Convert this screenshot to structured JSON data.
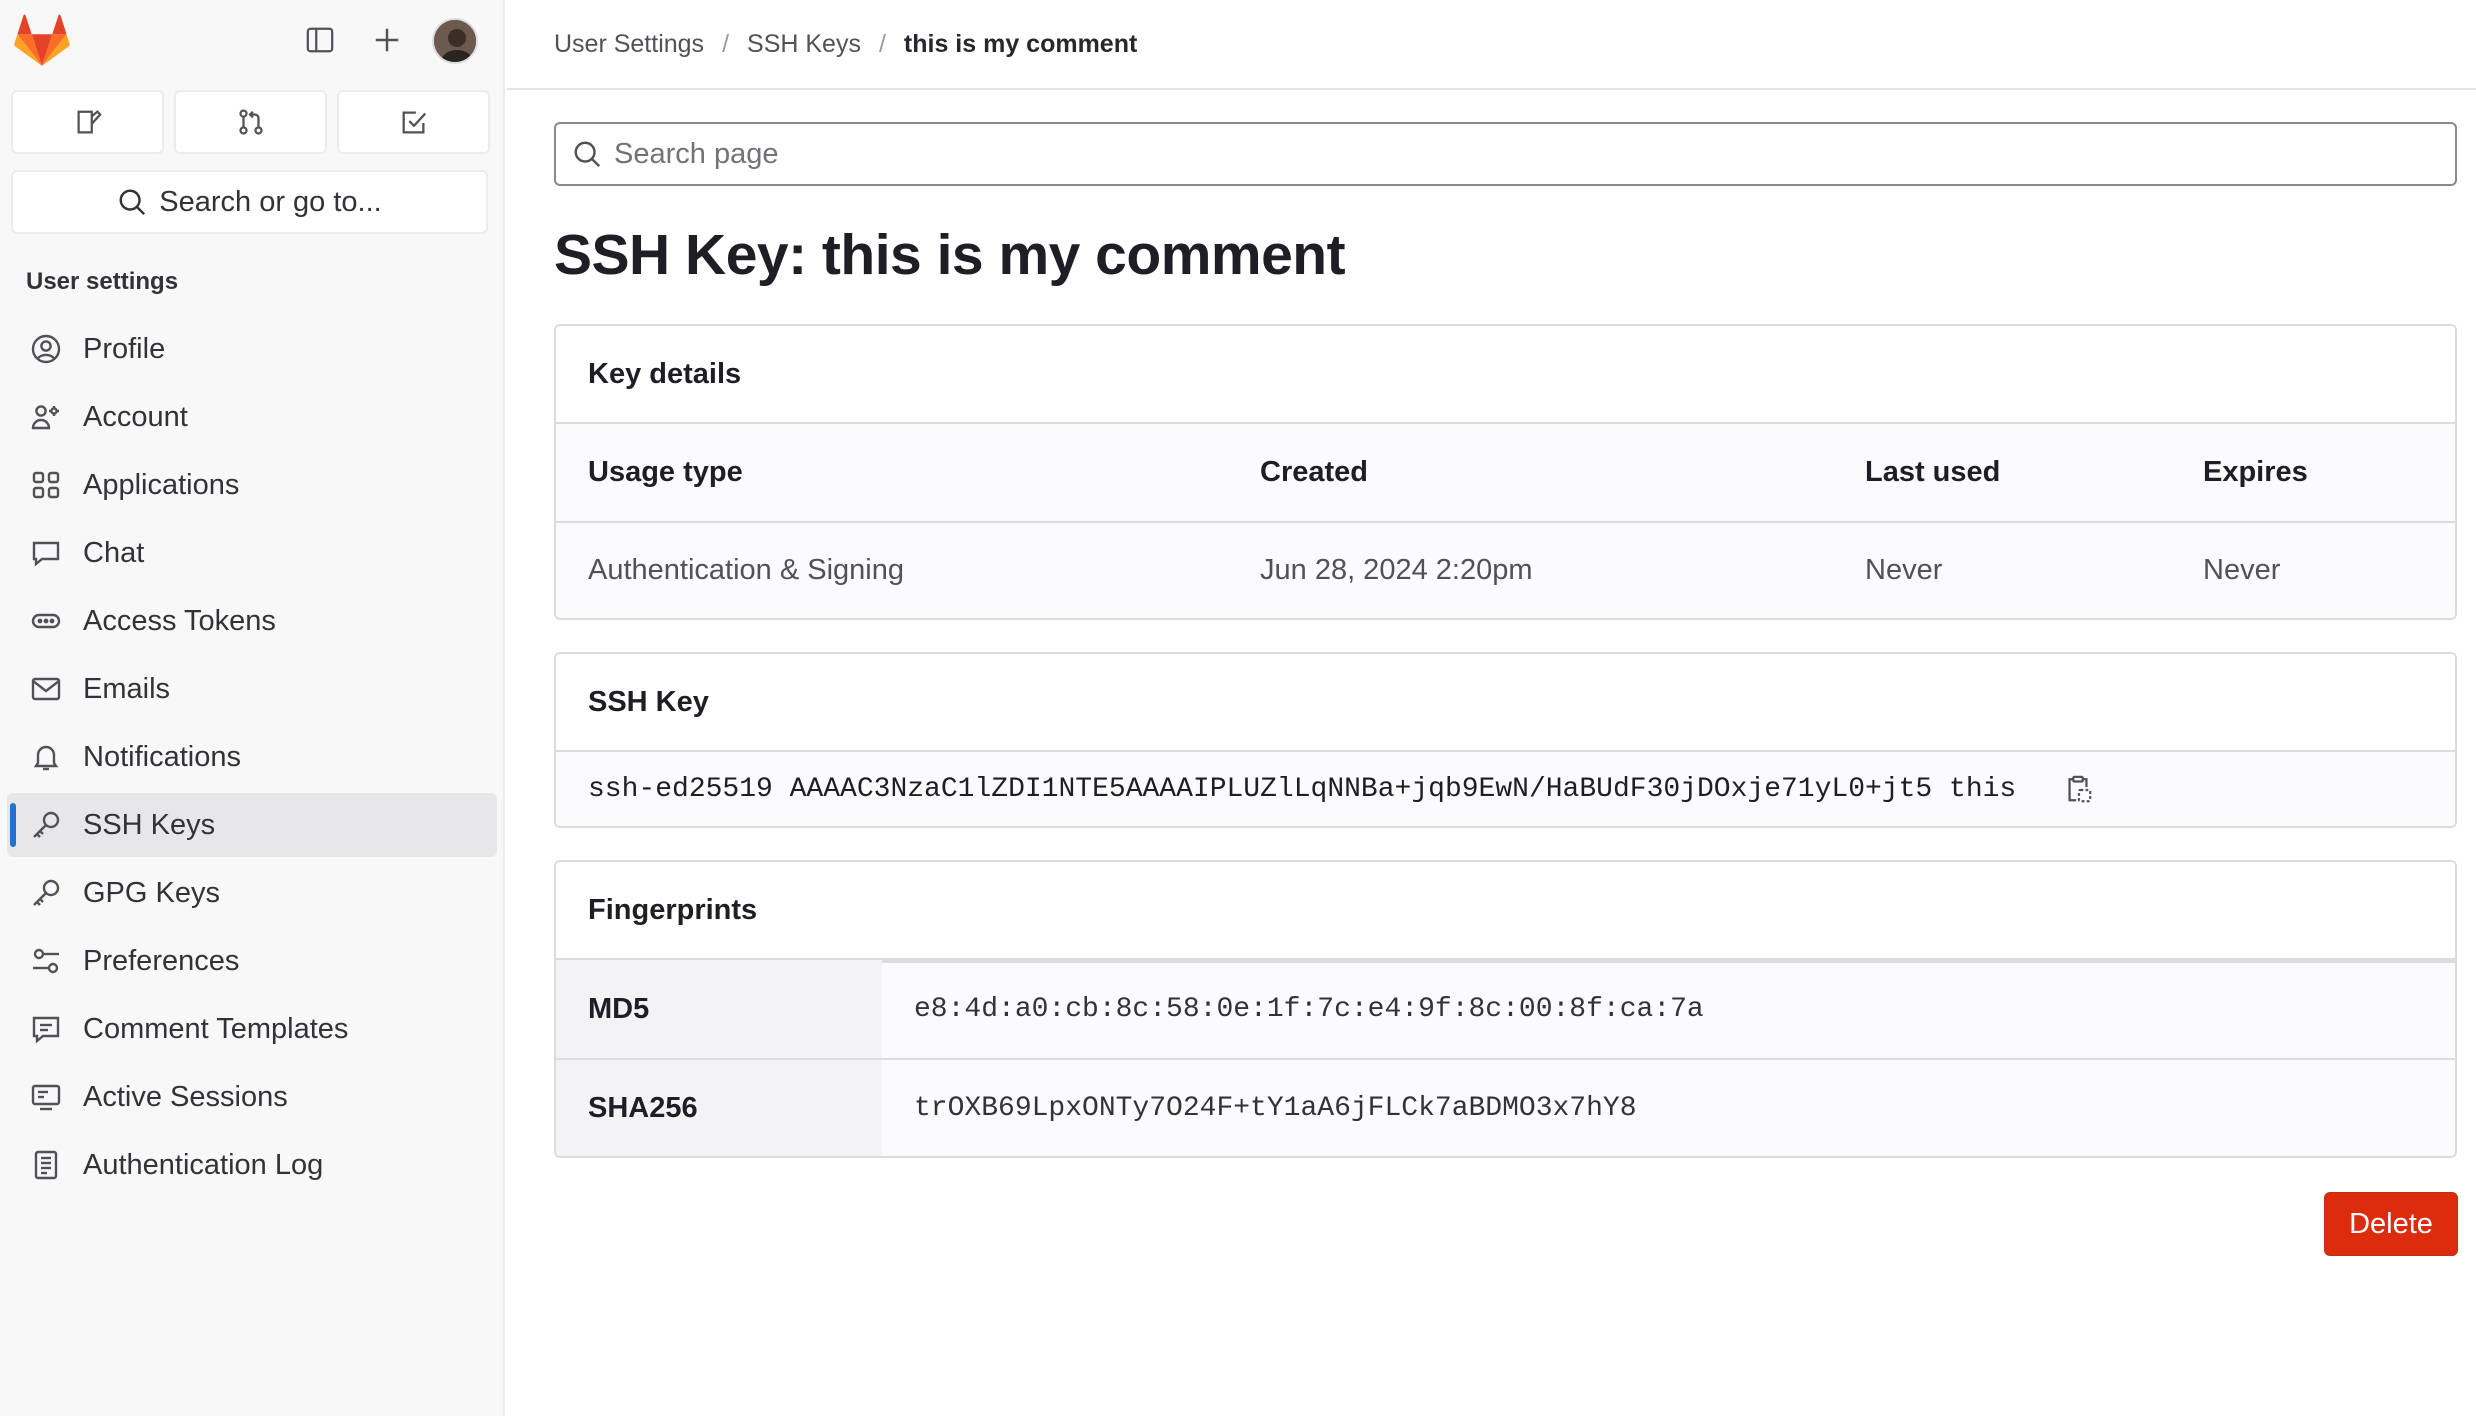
{
  "sidebar": {
    "quick_actions": [
      {
        "icon": "issues-icon"
      },
      {
        "icon": "merge-request-icon"
      },
      {
        "icon": "todo-icon"
      }
    ],
    "search_label": "Search or go to...",
    "section_title": "User settings",
    "items": [
      {
        "label": "Profile",
        "icon": "profile-icon"
      },
      {
        "label": "Account",
        "icon": "account-icon"
      },
      {
        "label": "Applications",
        "icon": "applications-icon"
      },
      {
        "label": "Chat",
        "icon": "chat-icon"
      },
      {
        "label": "Access Tokens",
        "icon": "token-icon"
      },
      {
        "label": "Emails",
        "icon": "mail-icon"
      },
      {
        "label": "Notifications",
        "icon": "bell-icon"
      },
      {
        "label": "SSH Keys",
        "icon": "key-icon",
        "active": true
      },
      {
        "label": "GPG Keys",
        "icon": "key-icon"
      },
      {
        "label": "Preferences",
        "icon": "preferences-icon"
      },
      {
        "label": "Comment Templates",
        "icon": "comment-icon"
      },
      {
        "label": "Active Sessions",
        "icon": "monitor-icon"
      },
      {
        "label": "Authentication Log",
        "icon": "log-icon"
      }
    ]
  },
  "breadcrumb": [
    "User Settings",
    "SSH Keys",
    "this is my comment"
  ],
  "search": {
    "placeholder": "Search page"
  },
  "page_title": "SSH Key: this is my comment",
  "key_details": {
    "title": "Key details",
    "headers": {
      "usage": "Usage type",
      "created": "Created",
      "last_used": "Last used",
      "expires": "Expires"
    },
    "row": {
      "usage": "Authentication & Signing",
      "created": "Jun 28, 2024 2:20pm",
      "last_used": "Never",
      "expires": "Never"
    }
  },
  "ssh_key": {
    "title": "SSH Key",
    "value": "ssh-ed25519 AAAAC3NzaC1lZDI1NTE5AAAAIPLUZlLqNNBa+jqb9EwN/HaBUdF30jDOxje71yL0+jt5 this"
  },
  "fingerprints": {
    "title": "Fingerprints",
    "rows": [
      {
        "label": "MD5",
        "value": "e8:4d:a0:cb:8c:58:0e:1f:7c:e4:9f:8c:00:8f:ca:7a"
      },
      {
        "label": "SHA256",
        "value": "trOXB69LpxONTy7O24F+tY1aA6jFLCk7aBDMO3x7hY8"
      }
    ]
  },
  "actions": {
    "delete_label": "Delete"
  },
  "colors": {
    "accent": "#1f75cb",
    "danger": "#dd2b0e",
    "logo": "#e24329"
  }
}
